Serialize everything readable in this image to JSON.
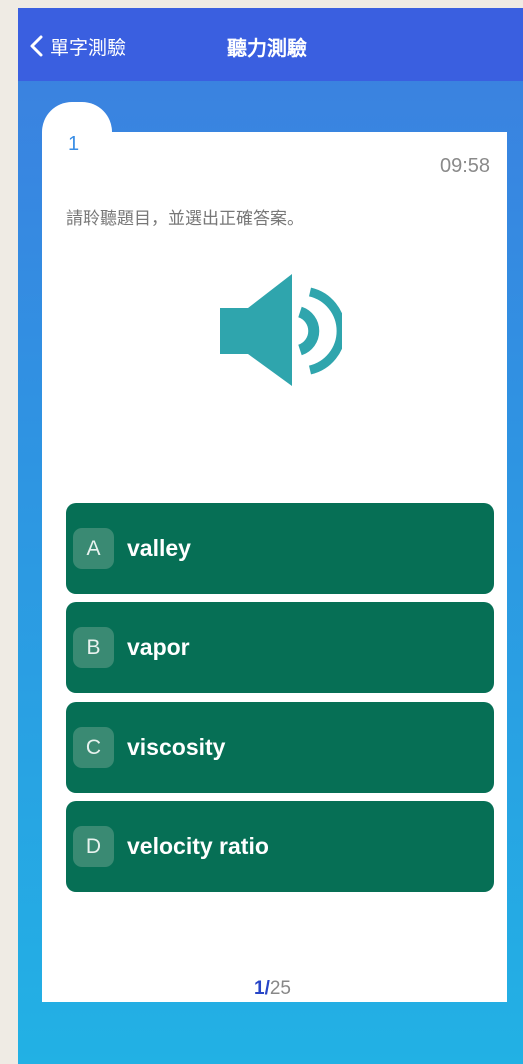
{
  "nav": {
    "back_label": "單字測驗",
    "title": "聽力測驗"
  },
  "question": {
    "number": "1",
    "timer": "09:58",
    "instruction": "請聆聽題目，並選出正確答案。"
  },
  "options": [
    {
      "letter": "A",
      "text": "valley"
    },
    {
      "letter": "B",
      "text": "vapor"
    },
    {
      "letter": "C",
      "text": "viscosity"
    },
    {
      "letter": "D",
      "text": "velocity ratio"
    }
  ],
  "pagination": {
    "current": "1",
    "separator": "/",
    "total": "25"
  },
  "colors": {
    "navbar": "#3a5fe0",
    "option_bg": "#066f55",
    "speaker": "#2fa5ad",
    "question_number": "#3a8ee6"
  },
  "icons": {
    "back": "chevron-left-icon",
    "audio": "speaker-icon"
  }
}
